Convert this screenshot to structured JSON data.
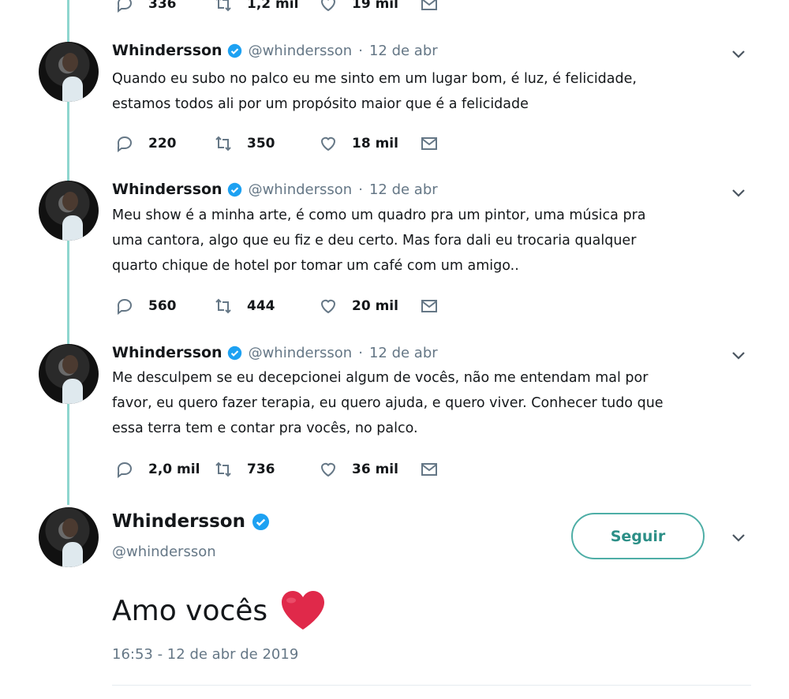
{
  "previous_tweet_actions": {
    "replies": "336",
    "retweets": "1,2 mil",
    "likes": "19 mil"
  },
  "tweets": [
    {
      "name": "Whindersson",
      "handle": "@whindersson",
      "separator": "·",
      "date": "12 de abr",
      "lines": [
        "Quando eu subo no palco eu me sinto em um lugar bom, é luz, é felicidade,",
        "estamos todos ali por um propósito maior que é a felicidade"
      ],
      "replies": "220",
      "retweets": "350",
      "likes": "18 mil"
    },
    {
      "name": "Whindersson",
      "handle": "@whindersson",
      "separator": "·",
      "date": "12 de abr",
      "lines": [
        "Meu show é a minha arte, é como um quadro pra um pintor, uma música pra",
        "uma cantora, algo que eu fiz e deu certo. Mas fora dali eu trocaria qualquer",
        "quarto chique de hotel por tomar um café com um amigo.."
      ],
      "replies": "560",
      "retweets": "444",
      "likes": "20 mil"
    },
    {
      "name": "Whindersson",
      "handle": "@whindersson",
      "separator": "·",
      "date": "12 de abr",
      "lines": [
        "Me desculpem se eu decepcionei algum de vocês, não me entendam mal por",
        "favor, eu quero fazer terapia, eu quero ajuda, e quero viver. Conhecer tudo que",
        "essa terra tem e contar pra vocês, no palco."
      ],
      "replies": "2,0 mil",
      "retweets": "736",
      "likes": "36 mil"
    }
  ],
  "main_tweet": {
    "name": "Whindersson",
    "handle": "@whindersson",
    "follow_label": "Seguir",
    "text": "Amo vocês",
    "timestamp": "16:53 - 12 de abr de 2019"
  },
  "colors": {
    "thread_line": "#8fd6cf",
    "verified": "#1da1f2",
    "follow": "#2c8f87",
    "heart": "#e0294a",
    "muted": "#657786"
  },
  "icons": {
    "reply": "reply-icon",
    "retweet": "retweet-icon",
    "like": "heart-icon",
    "dm": "envelope-icon",
    "caret": "chevron-down-icon",
    "verified": "verified-badge-icon"
  }
}
